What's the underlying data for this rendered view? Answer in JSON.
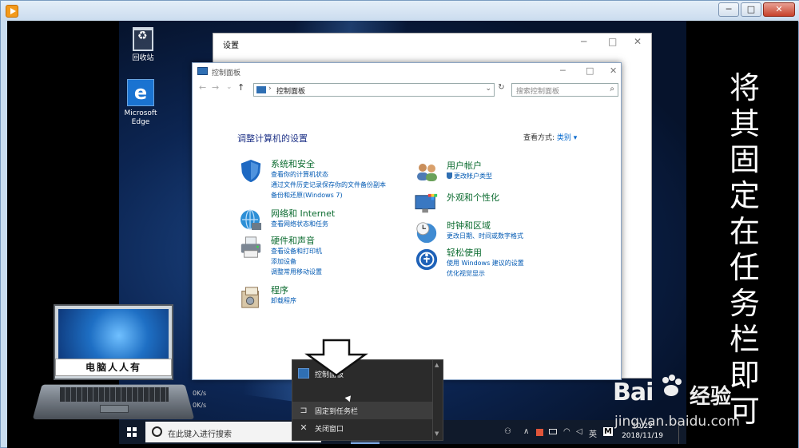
{
  "player": {
    "controls": {
      "minimize": "─",
      "maximize": "□",
      "close": "✕"
    }
  },
  "desktop": {
    "icons": [
      {
        "id": "recycle",
        "label": "回收站"
      },
      {
        "id": "edge",
        "label": "Microsoft\nEdge",
        "glyph": "e"
      }
    ]
  },
  "settings_window": {
    "title": "设置",
    "controls": {
      "minimize": "─",
      "maximize": "□",
      "close": "✕"
    }
  },
  "control_panel": {
    "title": "控制面板",
    "controls": {
      "minimize": "─",
      "maximize": "□",
      "close": "✕"
    },
    "nav": {
      "back": "←",
      "forward": "→",
      "recent": "⌄",
      "up": "↑"
    },
    "address": {
      "separator": "›",
      "path": "控制面板",
      "dropdown": "⌄"
    },
    "refresh": "↻",
    "search_placeholder": "搜索控制面板",
    "search_icon": "⌕",
    "heading": "调整计算机的设置",
    "view_by_label": "查看方式:",
    "view_by_value": "类别 ▾",
    "categories_left": [
      {
        "title": "系统和安全",
        "links": [
          "查看你的计算机状态",
          "通过文件历史记录保存你的文件备份副本",
          "备份和还原(Windows 7)"
        ],
        "icon": "shield-icon",
        "color": "#1e69c2"
      },
      {
        "title": "网络和 Internet",
        "links": [
          "查看网络状态和任务"
        ],
        "icon": "globe-network-icon",
        "color": "#2d8fd6"
      },
      {
        "title": "硬件和声音",
        "links": [
          "查看设备和打印机",
          "添加设备",
          "调整常用移动设置"
        ],
        "icon": "printer-icon",
        "color": "#7b8693"
      },
      {
        "title": "程序",
        "links": [
          "卸载程序"
        ],
        "icon": "programs-icon",
        "color": "#8a6f4d"
      }
    ],
    "categories_right": [
      {
        "title": "用户帐户",
        "links": [
          "更改帐户类型"
        ],
        "icon": "users-icon",
        "color": "#c98e5b"
      },
      {
        "title": "外观和个性化",
        "links": [],
        "icon": "monitor-palette-icon",
        "color": "#3a78c2"
      },
      {
        "title": "时钟和区域",
        "links": [
          "更改日期、时间或数字格式"
        ],
        "icon": "clock-globe-icon",
        "color": "#3f8bd2"
      },
      {
        "title": "轻松使用",
        "links": [
          "使用 Windows 建议的设置",
          "优化视觉显示"
        ],
        "icon": "ease-of-access-icon",
        "color": "#1f62b8"
      }
    ]
  },
  "jump_list": {
    "items": [
      {
        "label": "控制面板",
        "icon": "control-panel-icon"
      },
      {
        "label": "固定到任务栏",
        "icon": "pin-icon",
        "glyph": "⊐"
      },
      {
        "label": "关闭窗口",
        "icon": "close-icon",
        "glyph": "✕"
      }
    ],
    "scroll_up": "▲",
    "scroll_down": "▼"
  },
  "taskbar": {
    "search_placeholder": "在此键入进行搜索",
    "tray": {
      "person": "⚇",
      "chevron": "∧",
      "wifi": "◠",
      "volume": "◁",
      "ime": "英",
      "m_icon": "M"
    },
    "time": "10:22",
    "date": "2018/11/19"
  },
  "overlay": {
    "brand_banner": "电脑人人有",
    "calligraphy": [
      "将",
      "其",
      "固",
      "定",
      "在",
      "任",
      "务",
      "栏",
      "即",
      "可"
    ],
    "net_speed": [
      "0K/s",
      "0K/s"
    ],
    "watermark": {
      "logo": "Bai",
      "logo2": "经验",
      "url": "jingyan.baidu.com"
    }
  }
}
